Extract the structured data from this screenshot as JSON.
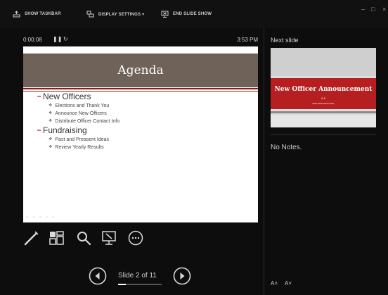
{
  "toolbar": {
    "show_taskbar": "SHOW TASKBAR",
    "display_settings": "DISPLAY SETTINGS ▾",
    "end_slide_show": "END SLIDE SHOW"
  },
  "window_controls": {
    "minimize": "–",
    "restore": "□",
    "close": "×"
  },
  "presenter": {
    "timer": "0:00:08",
    "pause_icon": "❚❚",
    "restart_icon": "↻",
    "clock": "3:53 PM"
  },
  "current_slide": {
    "title": "Agenda",
    "items": [
      {
        "text": "New Officers",
        "subitems": [
          "Elections and Thank You",
          "Announce New Officers",
          "Distribute Officer Contact Info"
        ]
      },
      {
        "text": "Fundraising",
        "subitems": [
          "Past and Preasent Ideas",
          "Review Yearly Results"
        ]
      }
    ],
    "bullet_glyph": "∞",
    "sub_bullet_glyph": "❖"
  },
  "tools": [
    "pen-icon",
    "see-all-slides-icon",
    "zoom-icon",
    "pointer-screen-icon",
    "more-options-icon"
  ],
  "navigation": {
    "slide_counter": "Slide 2 of 11",
    "current": 2,
    "total": 11
  },
  "next_slide": {
    "label": "Next slide",
    "title": "New Officer Announcement",
    "ornament": "ϐ     ϑ",
    "subtitle": "2014-2015 School Year"
  },
  "notes": "No Notes.",
  "font_buttons": {
    "increase": "A˄",
    "decrease": "A˅"
  },
  "colors": {
    "background": "#0d0d0d",
    "title_band": "#6f6259",
    "accent_red": "#b51f1f"
  }
}
